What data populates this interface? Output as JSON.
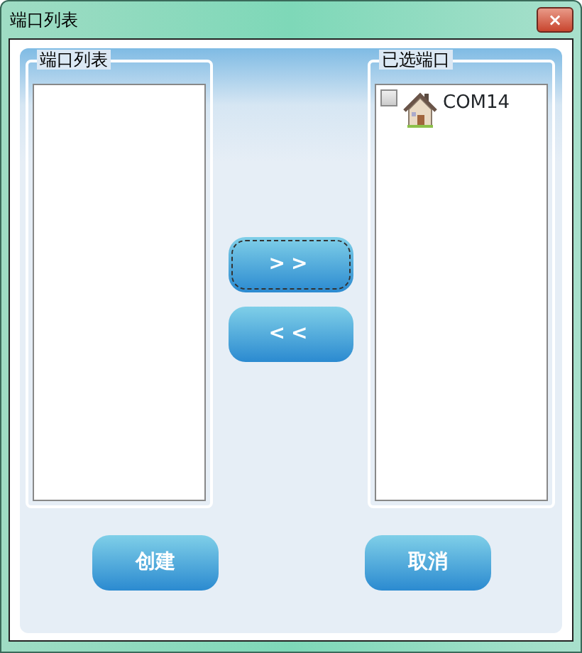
{
  "window": {
    "title": "端口列表",
    "close": "×"
  },
  "groups": [
    {
      "title": "端口列表"
    },
    {
      "title": "已选端口",
      "items": [
        {
          "label": "COM14",
          "checked": false
        }
      ]
    }
  ],
  "move_buttons": [
    {
      "label": ">>",
      "focused": true
    },
    {
      "label": "<<",
      "focused": false
    }
  ],
  "buttons": [
    "创建",
    "取消"
  ]
}
